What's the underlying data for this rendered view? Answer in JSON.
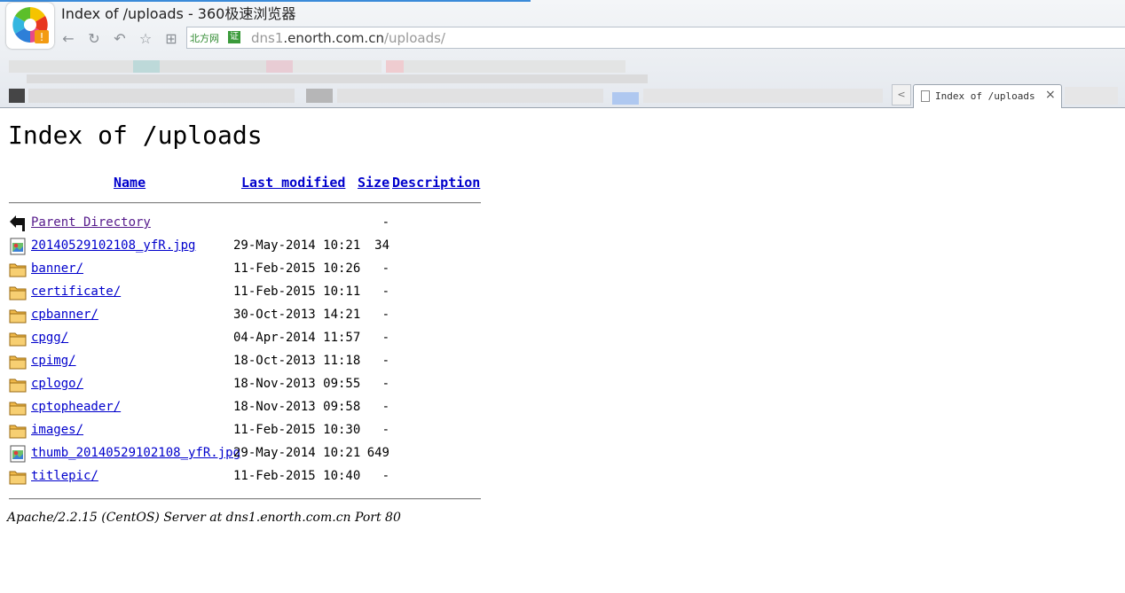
{
  "browser": {
    "window_title": "Index of /uploads - 360极速浏览器",
    "address_badge": "北方网",
    "address_cert": "证",
    "url_scheme": "dns1",
    "url_host": ".enorth.com.cn",
    "url_path": "/uploads/",
    "tab_title": "Index of /uploads",
    "tab_close": "×",
    "tab_scroll_left": "<",
    "nav_icons": [
      "back-icon",
      "reload-icon",
      "undo-icon",
      "favorite-star-icon",
      "apps-grid-icon"
    ]
  },
  "page": {
    "title": "Index of /uploads",
    "headers": {
      "name": "Name",
      "last_modified": "Last modified",
      "size": "Size",
      "description": "Description"
    },
    "rows": [
      {
        "name": "Parent Directory",
        "date": "",
        "size": "-",
        "icon": "back-arrow-icon"
      },
      {
        "name": "20140529102108_yfR.jpg",
        "date": "29-May-2014 10:21",
        "size": "34",
        "icon": "image-file-icon"
      },
      {
        "name": "banner/",
        "date": "11-Feb-2015 10:26",
        "size": "-",
        "icon": "folder-icon"
      },
      {
        "name": "certificate/",
        "date": "11-Feb-2015 10:11",
        "size": "-",
        "icon": "folder-icon"
      },
      {
        "name": "cpbanner/",
        "date": "30-Oct-2013 14:21",
        "size": "-",
        "icon": "folder-icon"
      },
      {
        "name": "cpgg/",
        "date": "04-Apr-2014 11:57",
        "size": "-",
        "icon": "folder-icon"
      },
      {
        "name": "cpimg/",
        "date": "18-Oct-2013 11:18",
        "size": "-",
        "icon": "folder-icon"
      },
      {
        "name": "cplogo/",
        "date": "18-Nov-2013 09:55",
        "size": "-",
        "icon": "folder-icon"
      },
      {
        "name": "cptopheader/",
        "date": "18-Nov-2013 09:58",
        "size": "-",
        "icon": "folder-icon"
      },
      {
        "name": "images/",
        "date": "11-Feb-2015 10:30",
        "size": "-",
        "icon": "folder-icon"
      },
      {
        "name": "thumb_20140529102108_yfR.jpg",
        "date": "29-May-2014 10:21",
        "size": "649",
        "icon": "image-file-icon"
      },
      {
        "name": "titlepic/",
        "date": "11-Feb-2015 10:40",
        "size": "-",
        "icon": "folder-icon"
      }
    ],
    "server_signature": "Apache/2.2.15 (CentOS) Server at dns1.enorth.com.cn Port 80"
  },
  "colors": {
    "link": "#0000cc",
    "visited_link": "#551a8b",
    "folder": "#f0b94a",
    "load_progress": "#3b8bd9"
  }
}
